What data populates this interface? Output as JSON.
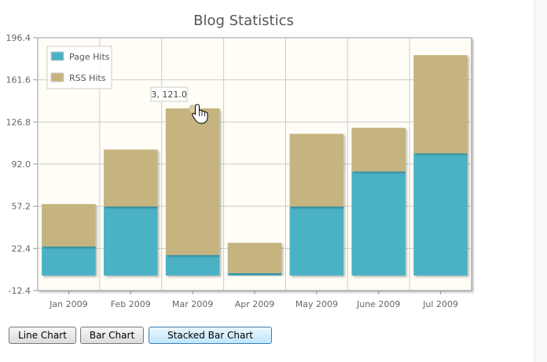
{
  "chart_data": {
    "type": "bar",
    "stacked": true,
    "title": "Blog Statistics",
    "categories": [
      "Jan 2009",
      "Feb 2009",
      "Mar 2009",
      "Apr 2009",
      "May 2009",
      "June 2009",
      "Jul 2009"
    ],
    "series": [
      {
        "name": "Page Hits",
        "color": "#4bb2c5",
        "values": [
          24,
          57,
          17,
          2,
          57,
          86,
          101
        ]
      },
      {
        "name": "RSS Hits",
        "color": "#c5b47f",
        "values": [
          35,
          47,
          121,
          25,
          60,
          36,
          81
        ]
      }
    ],
    "yticks": [
      "196.4",
      "161.6",
      "126.8",
      "92.0",
      "57.2",
      "22.4",
      "-12.4"
    ],
    "ylim": [
      -12.4,
      196.4
    ],
    "grid": true,
    "legend_position": "top-left",
    "tooltip": {
      "text": "3, 121.0",
      "category_index": 2,
      "series_index": 1
    }
  },
  "controls": {
    "line_label": "Line Chart",
    "bar_label": "Bar Chart",
    "stacked_label": "Stacked Bar Chart"
  }
}
